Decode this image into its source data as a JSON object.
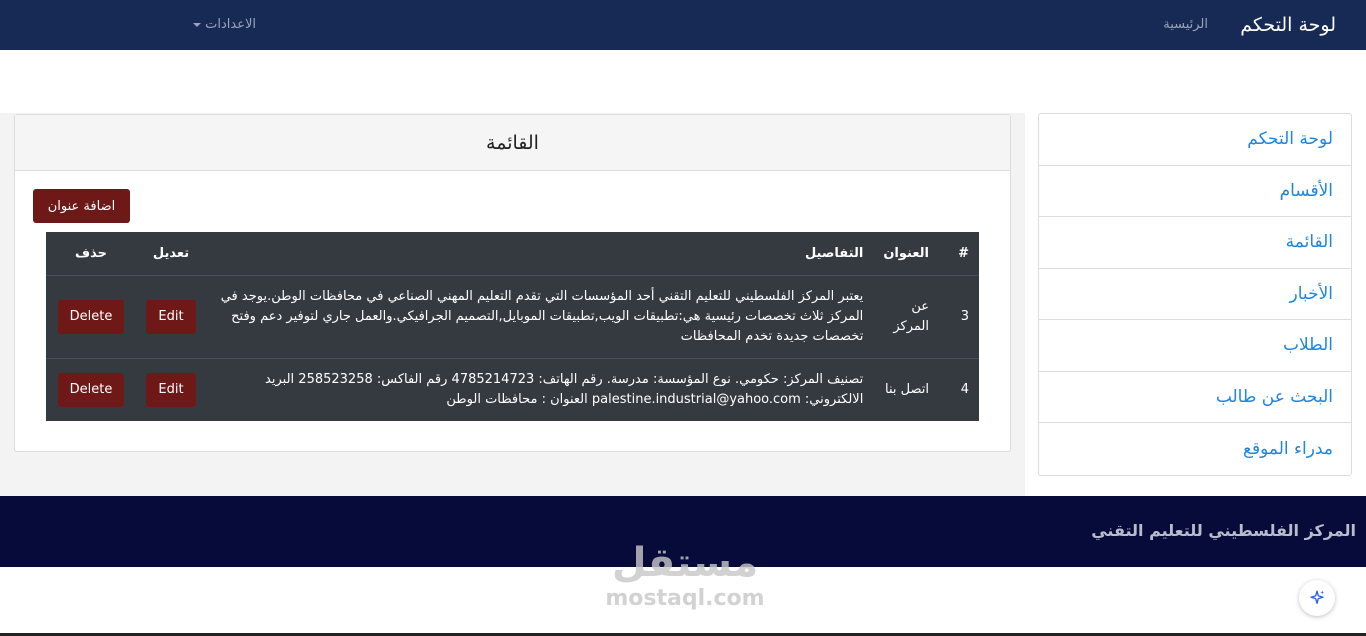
{
  "navbar": {
    "brand": "لوحة التحكم",
    "home": "الرئيسية",
    "settings": "الاعدادات"
  },
  "sidebar": {
    "items": [
      {
        "label": "لوحة التحكم"
      },
      {
        "label": "الأقسام"
      },
      {
        "label": "القائمة"
      },
      {
        "label": "الأخبار"
      },
      {
        "label": "الطلاب"
      },
      {
        "label": "البحث عن طالب"
      },
      {
        "label": "مدراء الموقع"
      }
    ]
  },
  "panel": {
    "title": "القائمة",
    "add_button": "اضافة عنوان"
  },
  "table": {
    "headers": {
      "num": "#",
      "title": "العنوان",
      "details": "التفاصيل",
      "edit": "تعديل",
      "delete": "حذف"
    },
    "rows": [
      {
        "num": "3",
        "title": "عن المركز",
        "details": "يعتبر المركز الفلسطيني للتعليم التقني أحد المؤسسات التي تقدم التعليم المهني الصناعي في محافظات الوطن.يوجد في المركز ثلاث تخصصات رئيسية هي:تطبيقات الويب,تطبيقات الموبايل,التصميم الجرافيكي.والعمل جاري لتوفير دعم وفتح تخصصات جديدة تخدم المحافظات",
        "edit": "Edit",
        "delete": "Delete"
      },
      {
        "num": "4",
        "title": "اتصل بنا",
        "details": "تصنيف المركز: حكومي. نوع المؤسسة: مدرسة. رقم الهاتف: 4785214723 رقم الفاكس: 258523258 البريد الالكتروني: palestine.industrial@yahoo.com العنوان : محافظات الوطن",
        "edit": "Edit",
        "delete": "Delete"
      }
    ]
  },
  "footer": {
    "text": "المركز الفلسطيني للتعليم التقني"
  },
  "watermark": {
    "arabic": "مستقل",
    "latin": "mostaql.com"
  },
  "colors": {
    "navbar": "#172a55",
    "footer": "#070b3a",
    "button": "#6e1818",
    "link": "#1e86e0",
    "table": "#343a40"
  }
}
